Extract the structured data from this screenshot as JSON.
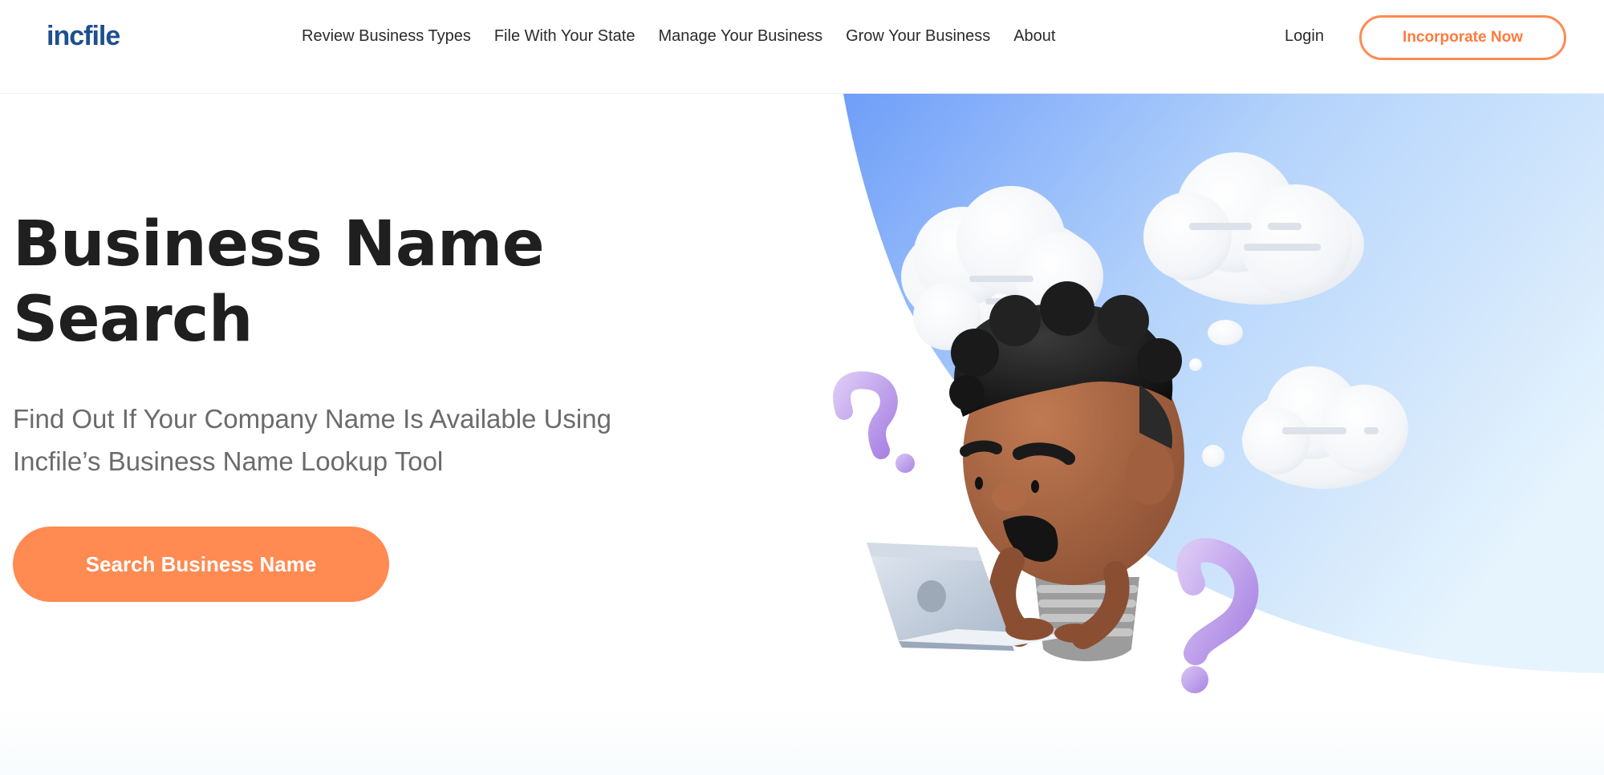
{
  "header": {
    "logo_text": "incfile",
    "nav": [
      {
        "label": "Review Business Types"
      },
      {
        "label": "File With Your State"
      },
      {
        "label": "Manage Your Business"
      },
      {
        "label": "Grow Your Business"
      },
      {
        "label": "About"
      }
    ],
    "login_label": "Login",
    "cta_label": "Incorporate Now"
  },
  "hero": {
    "title_line1": "Business Name",
    "title_line2": "Search",
    "subtitle_line1": "Find Out If Your Company Name Is Available Using",
    "subtitle_line2": "Incfile’s Business Name Lookup Tool",
    "cta_label": "Search Business Name"
  },
  "colors": {
    "brand_blue": "#1d4f91",
    "accent_orange": "#ff8a52",
    "bg_blue_start": "#6f9ef8",
    "bg_blue_end": "#e3f2fd"
  },
  "icons": [
    "thought-cloud-icon",
    "question-mark-icon",
    "laptop-icon",
    "person-icon"
  ]
}
